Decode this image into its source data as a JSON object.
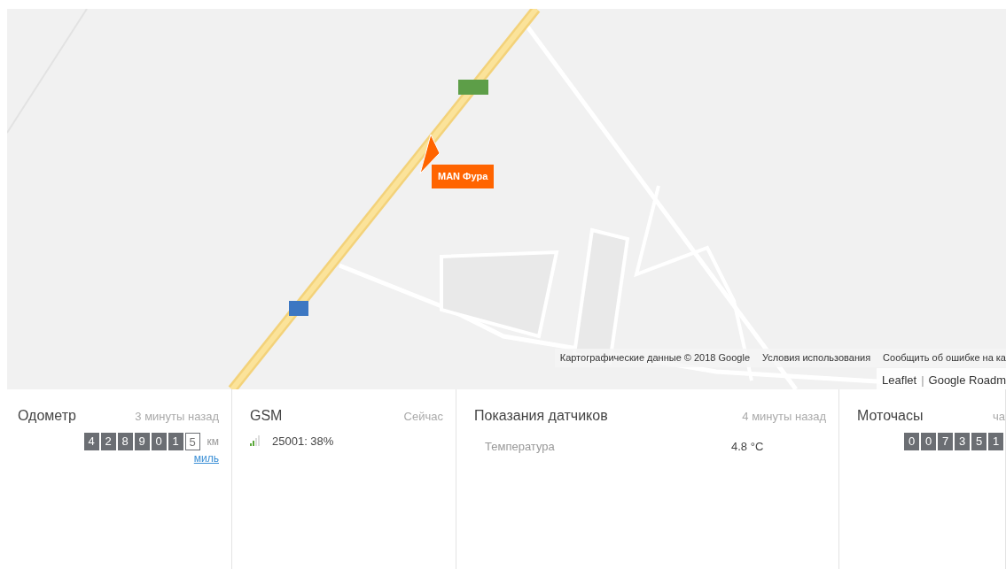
{
  "map": {
    "kind": "picture",
    "marker": {
      "label": "MAN Фура"
    },
    "attribution": [
      "Картографические данные © 2018 Google",
      "Условия использования",
      "Сообщить об ошибке на ка"
    ],
    "layers": {
      "link": "Leaflet",
      "separator": "|",
      "layer": "Google Roadm"
    }
  },
  "widgets": [
    {
      "kind": "odometer",
      "title": "Одометр",
      "time": "3 минуты назад",
      "digits": [
        {
          "digit": "4",
          "kind": "integer"
        },
        {
          "digit": "2",
          "kind": "integer"
        },
        {
          "digit": "8",
          "kind": "integer"
        },
        {
          "digit": "9",
          "kind": "integer"
        },
        {
          "digit": "0",
          "kind": "integer"
        },
        {
          "digit": "1",
          "kind": "integer"
        },
        {
          "digit": "5",
          "kind": "decimal"
        }
      ],
      "unit": "км",
      "alt_unit": "миль"
    },
    {
      "kind": "gsm",
      "title": "GSM",
      "time": "Сейчас",
      "value": "25001: 38%"
    },
    {
      "kind": "sensors",
      "title": "Показания датчиков",
      "time": "4 минуты назад",
      "rows": [
        {
          "name": "Температура",
          "value": "4.8 °C"
        }
      ]
    },
    {
      "kind": "counter",
      "title": "Моточасы",
      "time": "ча",
      "digits": [
        {
          "digit": "0",
          "kind": "integer"
        },
        {
          "digit": "0",
          "kind": "integer"
        },
        {
          "digit": "7",
          "kind": "integer"
        },
        {
          "digit": "3",
          "kind": "integer"
        },
        {
          "digit": "5",
          "kind": "integer"
        },
        {
          "digit": "1",
          "kind": "integer"
        }
      ]
    }
  ]
}
